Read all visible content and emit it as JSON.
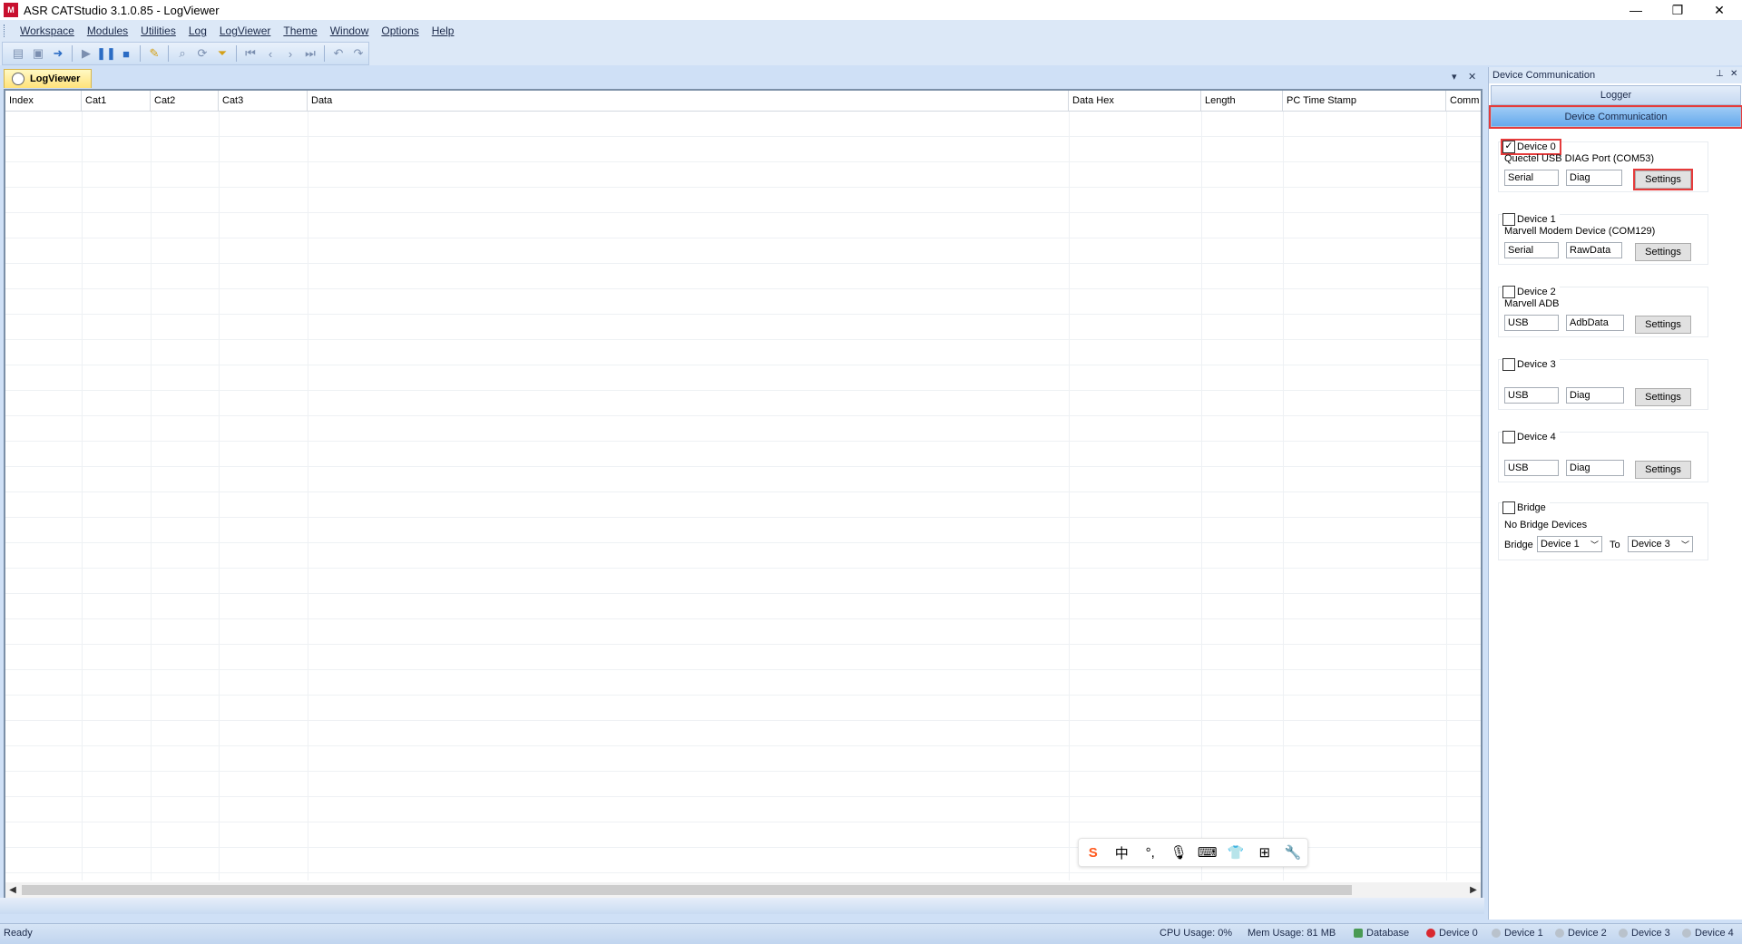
{
  "window": {
    "title": "ASR CATStudio 3.1.0.85 - LogViewer",
    "app_icon_text": "M",
    "minimize": "—",
    "restore": "❐",
    "close": "✕"
  },
  "menu": {
    "items": [
      "Workspace",
      "Modules",
      "Utilities",
      "Log",
      "LogViewer",
      "Theme",
      "Window",
      "Options",
      "Help"
    ]
  },
  "document": {
    "tab_label": "LogViewer",
    "dropdown": "▾",
    "close": "✕"
  },
  "grid": {
    "columns": [
      "Index",
      "Cat1",
      "Cat2",
      "Cat3",
      "Data",
      "Data Hex",
      "Length",
      "PC Time Stamp",
      "Comm"
    ]
  },
  "ime": {
    "buttons": [
      "S",
      "中",
      "°,",
      "🎙",
      "⌨",
      "👕",
      "⊞",
      "🔧"
    ]
  },
  "panel": {
    "title": "Device Communication",
    "pin": "⊥",
    "close": "✕",
    "tabs": [
      "Logger",
      "Device Communication"
    ],
    "active_tab": "Device Communication",
    "devices": [
      {
        "label": "Device 0",
        "checked": true,
        "name": "Quectel USB DIAG Port (COM53)",
        "field1": "Serial",
        "field2": "Diag",
        "button": "Settings"
      },
      {
        "label": "Device 1",
        "checked": false,
        "name": "Marvell Modem Device (COM129)",
        "field1": "Serial",
        "field2": "RawData",
        "button": "Settings"
      },
      {
        "label": "Device 2",
        "checked": false,
        "name": "Marvell ADB",
        "field1": "USB",
        "field2": "AdbData",
        "button": "Settings"
      },
      {
        "label": "Device 3",
        "checked": false,
        "name": "",
        "field1": "USB",
        "field2": "Diag",
        "button": "Settings"
      },
      {
        "label": "Device 4",
        "checked": false,
        "name": "",
        "field1": "USB",
        "field2": "Diag",
        "button": "Settings"
      }
    ],
    "bridge": {
      "label": "Bridge",
      "checked": false,
      "status": "No Bridge Devices",
      "bridge_label": "Bridge",
      "from": "Device 1",
      "to_label": "To",
      "to": "Device 3"
    }
  },
  "status": {
    "ready": "Ready",
    "cpu": "CPU Usage:  0%",
    "mem": "Mem Usage: 81 MB",
    "database": "Database",
    "devices": [
      "Device 0",
      "Device 1",
      "Device 2",
      "Device 3",
      "Device 4"
    ]
  },
  "colors": {
    "highlight": "#e53b3b",
    "active_tab": "#66a9ec",
    "device0_status": "#d9282f"
  }
}
